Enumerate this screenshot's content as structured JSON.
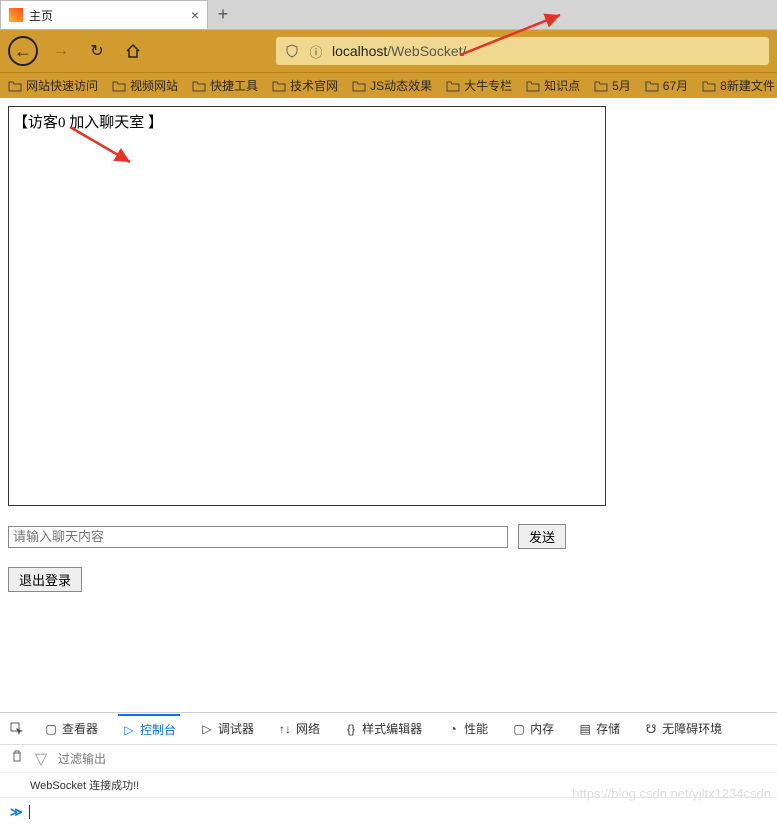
{
  "browser": {
    "tab_title": "主页",
    "url_host": "localhost",
    "url_path": "/WebSocket/",
    "bookmarks": [
      "网站快速访问",
      "视频网站",
      "快捷工具",
      "技术官网",
      "JS动态效果",
      "大牛专栏",
      "知识点",
      "5月",
      "67月",
      "8新建文件"
    ]
  },
  "chat": {
    "message": "【访客0 加入聊天室 】",
    "input_placeholder": "请输入聊天内容",
    "send_label": "发送",
    "logout_label": "退出登录"
  },
  "devtools": {
    "tabs": {
      "inspector": "查看器",
      "console": "控制台",
      "debugger": "调试器",
      "network": "网络",
      "style": "样式编辑器",
      "performance": "性能",
      "memory": "内存",
      "storage": "存储",
      "accessibility": "无障碍环境"
    },
    "filter_placeholder": "过滤输出",
    "console_message": "WebSocket 连接成功!!",
    "prompt": "≫"
  },
  "watermark": "https://blog.csdn.net/yjltx1234csdn"
}
